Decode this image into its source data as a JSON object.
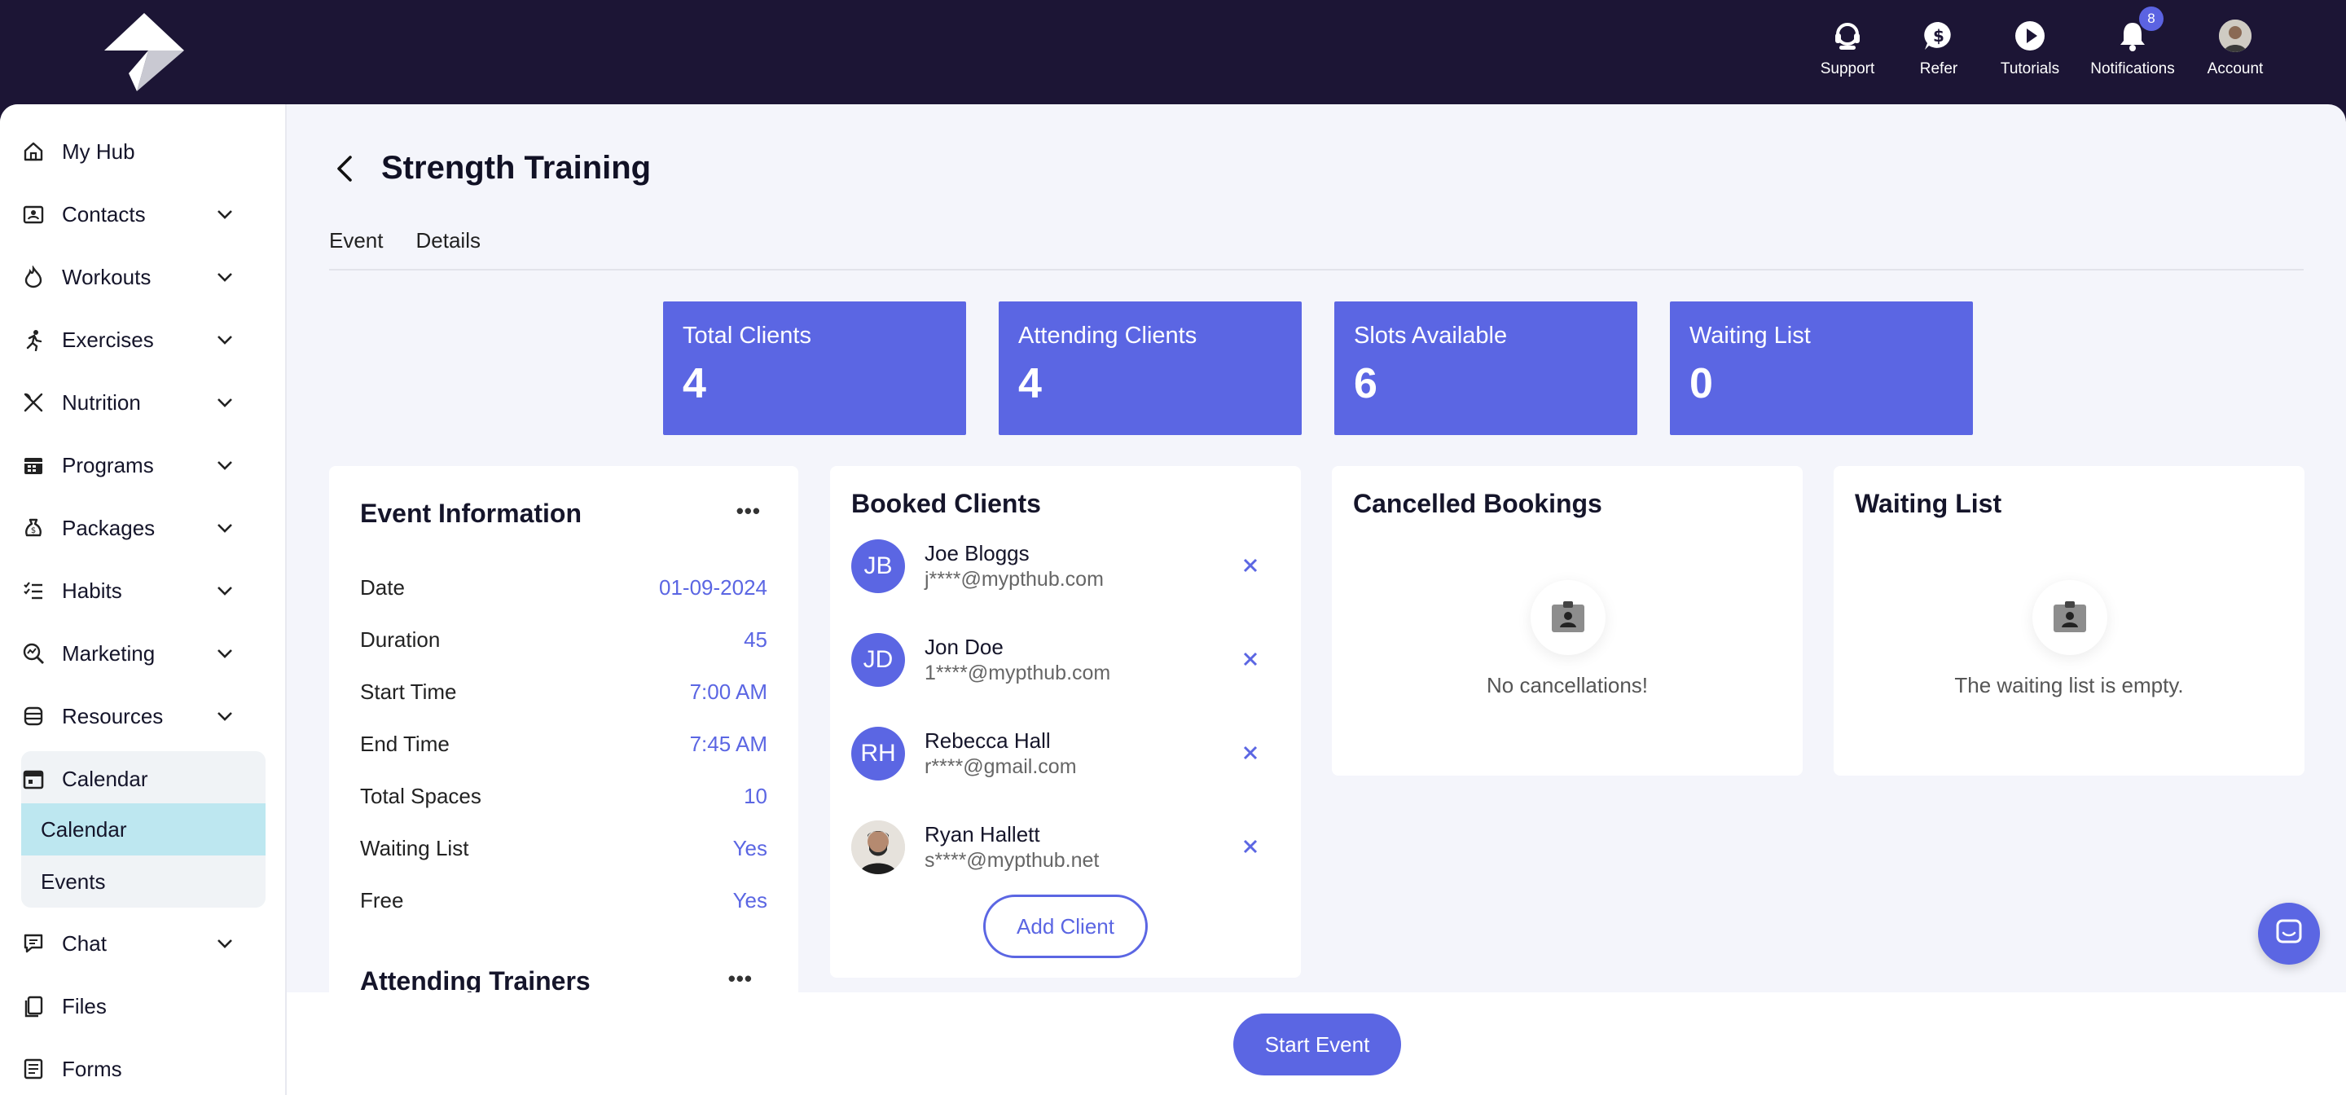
{
  "header": {
    "actions": [
      {
        "label": "Support",
        "icon": "support-headset-icon"
      },
      {
        "label": "Refer",
        "icon": "dollar-chat-icon"
      },
      {
        "label": "Tutorials",
        "icon": "play-circle-icon"
      },
      {
        "label": "Notifications",
        "icon": "bell-icon",
        "badge": "8"
      },
      {
        "label": "Account",
        "icon": "avatar"
      }
    ]
  },
  "sidebar": {
    "items": [
      {
        "label": "My Hub",
        "icon": "home-icon",
        "expandable": false
      },
      {
        "label": "Contacts",
        "icon": "contacts-icon",
        "expandable": true
      },
      {
        "label": "Workouts",
        "icon": "flame-icon",
        "expandable": true
      },
      {
        "label": "Exercises",
        "icon": "running-icon",
        "expandable": true
      },
      {
        "label": "Nutrition",
        "icon": "utensils-icon",
        "expandable": true
      },
      {
        "label": "Programs",
        "icon": "calendar-grid-icon",
        "expandable": true
      },
      {
        "label": "Packages",
        "icon": "money-bag-icon",
        "expandable": true
      },
      {
        "label": "Habits",
        "icon": "checklist-icon",
        "expandable": true
      },
      {
        "label": "Marketing",
        "icon": "search-chart-icon",
        "expandable": true
      },
      {
        "label": "Resources",
        "icon": "database-icon",
        "expandable": true
      }
    ],
    "calendar": {
      "label": "Calendar",
      "sub": [
        "Calendar",
        "Events"
      ],
      "active_sub": "Calendar"
    },
    "bottom_items": [
      {
        "label": "Chat",
        "icon": "chat-icon",
        "expandable": true
      },
      {
        "label": "Files",
        "icon": "files-icon",
        "expandable": false
      },
      {
        "label": "Forms",
        "icon": "forms-icon",
        "expandable": false
      }
    ]
  },
  "page": {
    "title": "Strength Training",
    "tabs": [
      "Event",
      "Details"
    ]
  },
  "stats": [
    {
      "label": "Total Clients",
      "value": "4"
    },
    {
      "label": "Attending Clients",
      "value": "4"
    },
    {
      "label": "Slots Available",
      "value": "6"
    },
    {
      "label": "Waiting List",
      "value": "0"
    }
  ],
  "event_info": {
    "title": "Event Information",
    "rows": [
      {
        "label": "Date",
        "value": "01-09-2024"
      },
      {
        "label": "Duration",
        "value": "45"
      },
      {
        "label": "Start Time",
        "value": "7:00 AM"
      },
      {
        "label": "End Time",
        "value": "7:45 AM"
      },
      {
        "label": "Total Spaces",
        "value": "10"
      },
      {
        "label": "Waiting List",
        "value": "Yes"
      },
      {
        "label": "Free",
        "value": "Yes"
      }
    ],
    "trainers_title": "Attending Trainers"
  },
  "booked_clients": {
    "title": "Booked Clients",
    "clients": [
      {
        "initials": "JB",
        "name": "Joe Bloggs",
        "email": "j****@mypthub.com"
      },
      {
        "initials": "JD",
        "name": "Jon Doe",
        "email": "1****@mypthub.com"
      },
      {
        "initials": "RH",
        "name": "Rebecca Hall",
        "email": "r****@gmail.com"
      },
      {
        "initials": "",
        "name": "Ryan Hallett",
        "email": "s****@mypthub.net"
      }
    ],
    "add_label": "Add Client"
  },
  "cancelled": {
    "title": "Cancelled Bookings",
    "empty": "No cancellations!"
  },
  "waiting": {
    "title": "Waiting List",
    "empty": "The waiting list is empty."
  },
  "footer": {
    "start_label": "Start Event"
  }
}
